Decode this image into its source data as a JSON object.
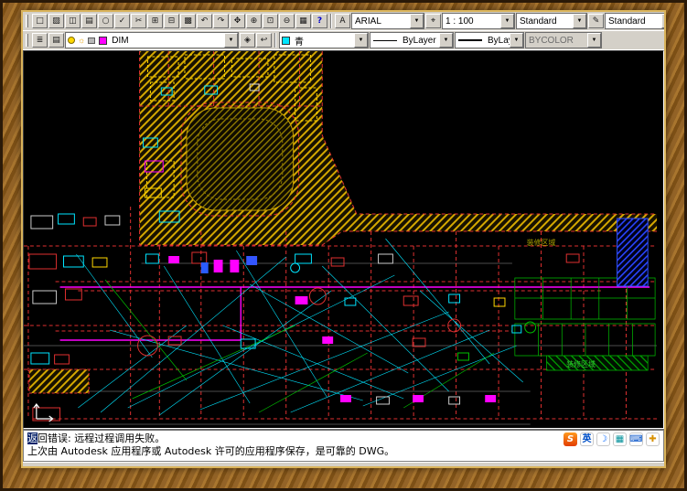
{
  "palette": {
    "toolbar_bg": "#d4d0c8",
    "canvas_bg": "#000000",
    "hatch_yellow": "#d4a800",
    "accent_red": "#e03030",
    "accent_cyan": "#00e5ff",
    "accent_magenta": "#ff00ff",
    "accent_green": "#00c000",
    "hatch_blue": "#2945ff",
    "selection_blue": "#0a246a"
  },
  "icons": {
    "combo_arrow": "▼",
    "sun_glyph": "☼"
  },
  "toolbar1": {
    "icons": [
      {
        "name": "new-file-icon",
        "glyph": "□"
      },
      {
        "name": "open-file-icon",
        "glyph": "▨"
      },
      {
        "name": "save-icon",
        "glyph": "◫"
      },
      {
        "name": "print-icon",
        "glyph": "▤"
      },
      {
        "name": "print-preview-icon",
        "glyph": "○"
      },
      {
        "name": "spelling-icon",
        "glyph": "✓"
      },
      {
        "name": "cut-icon",
        "glyph": "✂"
      },
      {
        "name": "copy-icon",
        "glyph": "⊞"
      },
      {
        "name": "paste-icon",
        "glyph": "⊟"
      },
      {
        "name": "match-properties-icon",
        "glyph": "▩"
      },
      {
        "name": "undo-icon",
        "glyph": "↶"
      },
      {
        "name": "redo-icon",
        "glyph": "↷"
      },
      {
        "name": "pan-icon",
        "glyph": "✥"
      },
      {
        "name": "zoom-realtime-icon",
        "glyph": "⊕"
      },
      {
        "name": "zoom-window-icon",
        "glyph": "⊡"
      },
      {
        "name": "zoom-previous-icon",
        "glyph": "⊖"
      },
      {
        "name": "properties-icon",
        "glyph": "▦"
      },
      {
        "name": "autocad-help-icon",
        "glyph": "?",
        "variant": "help"
      }
    ],
    "style_icon": "A",
    "dim_icon": "⌖",
    "annot_icon": "✎",
    "text_style_combo": "ARIAL",
    "scale_combo": "1 : 100",
    "dim_style_combo": "Standard",
    "current_standard_combo": "Standard"
  },
  "toolbar2": {
    "icons_left": [
      {
        "name": "layers-icon",
        "glyph": "≣"
      },
      {
        "name": "layer-manager-icon",
        "glyph": "▤"
      }
    ],
    "layer_combo": {
      "name": "DIM"
    },
    "icons_mid": [
      {
        "name": "make-layer-current-icon",
        "glyph": "◈"
      },
      {
        "name": "layer-previous-icon",
        "glyph": "↩"
      }
    ],
    "color_combo": {
      "label": "青"
    },
    "linetype_combo": "ByLayer",
    "lineweight_combo": "ByLayer",
    "plotstyle_combo": "BYCOLOR"
  },
  "drawing": {
    "labels": [
      {
        "text": "装修区域"
      },
      {
        "text": "装修区域"
      }
    ]
  },
  "command": {
    "line1_selected": "返",
    "line1_rest": "回错误: 远程过程调用失败。",
    "line2": "上次由 Autodesk 应用程序或 Autodesk 许可的应用程序保存，是可靠的 DWG。"
  },
  "tray": {
    "icons": [
      {
        "name": "sogou-logo-icon",
        "glyph": "S",
        "variant": "sogou"
      },
      {
        "name": "input-lang-icon",
        "glyph": "英",
        "variant": "lang"
      },
      {
        "name": "input-moon-icon",
        "glyph": "☽",
        "variant": "moon"
      },
      {
        "name": "input-board-icon",
        "glyph": "▦",
        "variant": "board"
      },
      {
        "name": "soft-keyboard-icon",
        "glyph": "⌨",
        "variant": "kbd"
      },
      {
        "name": "input-tools-icon",
        "glyph": "✚",
        "variant": "tools"
      }
    ]
  }
}
